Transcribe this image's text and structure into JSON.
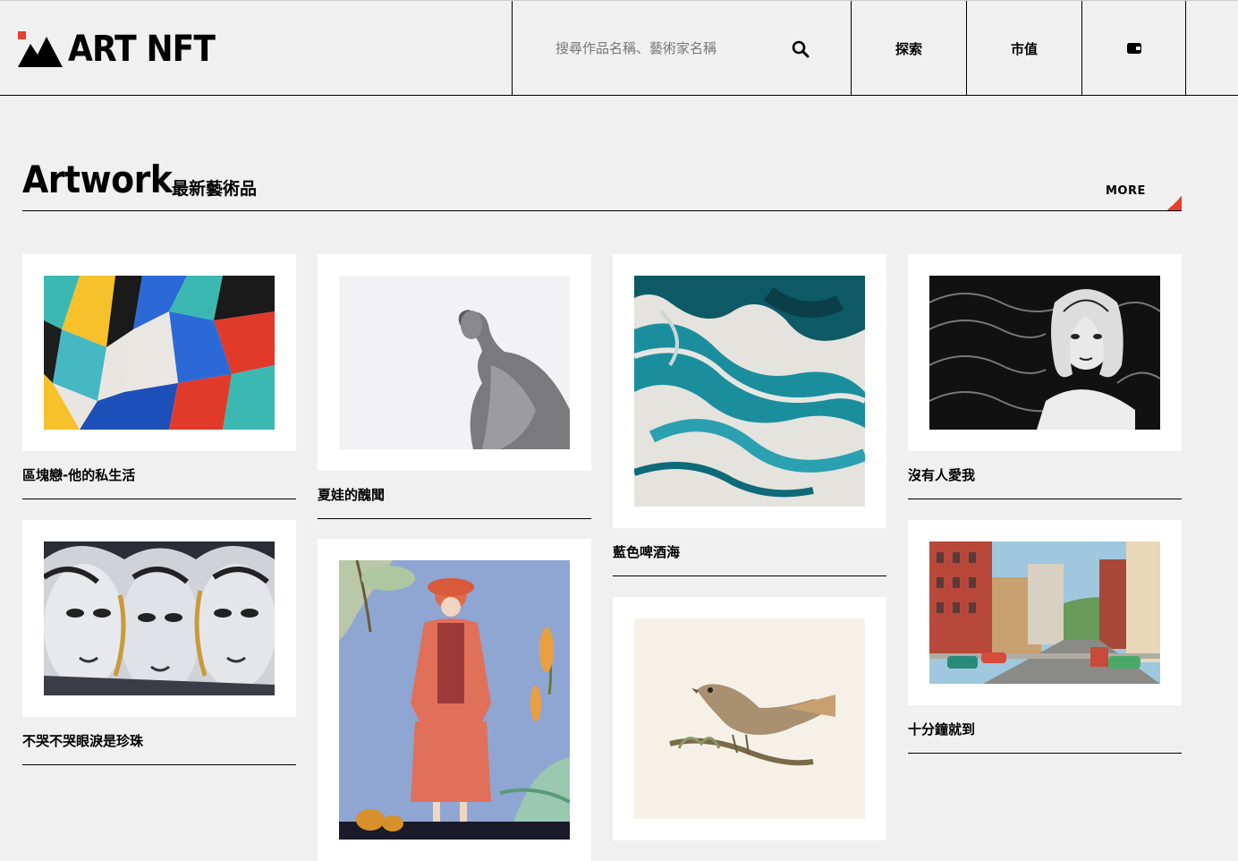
{
  "header": {
    "logo_text": "ART NFT",
    "search_placeholder": "搜尋作品名稱、藝術家名稱",
    "nav": [
      {
        "label": "探索"
      },
      {
        "label": "市值"
      }
    ],
    "wallet_icon": "wallet-icon",
    "search_icon": "search-icon"
  },
  "section": {
    "title": "Artwork",
    "subtitle": "最新藝術品",
    "more_label": "MORE"
  },
  "artworks": [
    {
      "title": "區塊戀-他的私生活"
    },
    {
      "title": "夏娃的醜聞"
    },
    {
      "title": "藍色啤酒海"
    },
    {
      "title": "沒有人愛我"
    },
    {
      "title": "不哭不哭眼淚是珍珠"
    },
    {
      "title": ""
    },
    {
      "title": ""
    },
    {
      "title": "十分鐘就到"
    }
  ],
  "colors": {
    "accent": "#e5412d",
    "background": "#f0f0f0"
  }
}
